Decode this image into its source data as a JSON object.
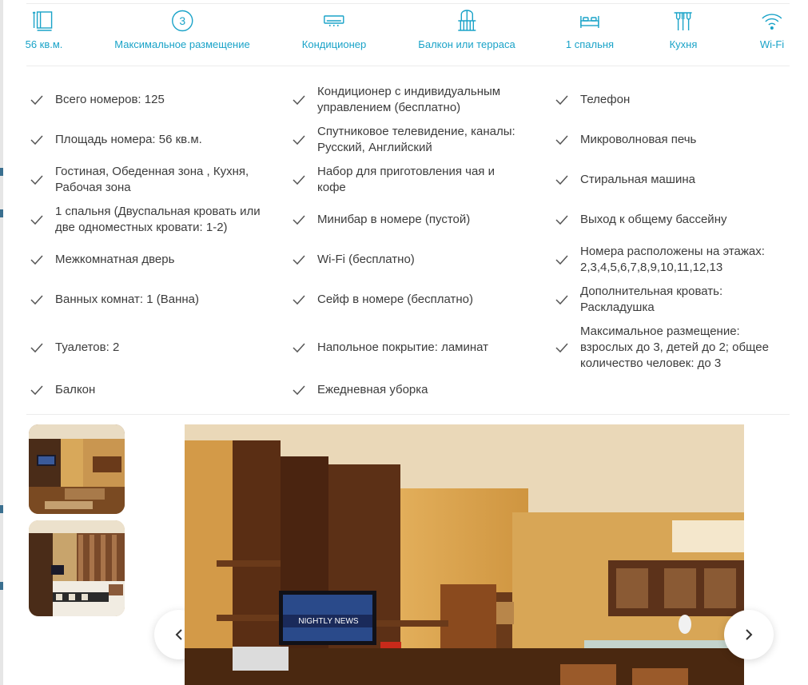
{
  "amenities": [
    {
      "label": "56 кв.м.",
      "icon": "area-icon"
    },
    {
      "label": "Максимальное размещение",
      "icon": "guests-count-icon",
      "badge": "3"
    },
    {
      "label": "Кондиционер",
      "icon": "air-conditioner-icon"
    },
    {
      "label": "Балкон или терраса",
      "icon": "balcony-icon"
    },
    {
      "label": "1 спальня",
      "icon": "bed-icon"
    },
    {
      "label": "Кухня",
      "icon": "kitchen-icon"
    },
    {
      "label": "Wi-Fi",
      "icon": "wifi-icon"
    }
  ],
  "features": {
    "col1": [
      "Всего номеров: 125",
      "Площадь номера: 56 кв.м.",
      "Гостиная, Обеденная зона , Кухня,\nРабочая зона",
      "1 спальня (Двуспальная кровать или\nдве одноместных кровати: 1-2)",
      "Межкомнатная дверь",
      "Ванных комнат: 1 (Ванна)",
      "Туалетов: 2",
      "Балкон"
    ],
    "col2": [
      "Кондиционер с индивидуальным\nуправлением (бесплатно)",
      "Спутниковое телевидение, каналы:\nРусский, Английский",
      "Набор для приготовления чая и\nкофе",
      "Минибар в номере (пустой)",
      "Wi-Fi (бесплатно)",
      "Сейф в номере (бесплатно)",
      "Напольное покрытие: ламинат",
      "Ежедневная уборка"
    ],
    "col3": [
      "Телефон",
      "Микроволновая печь",
      "Стиральная машина",
      "Выход к общему бассейну",
      "Номера расположены на этажах:\n2,3,4,5,6,7,8,9,10,11,12,13",
      "Дополнительная кровать:\nРаскладушка",
      "Максимальное размещение:\nвзрослых до 3, детей до 2; общее\nколичество человек: до 3"
    ]
  },
  "gallery": {
    "tv_caption": "NIGHTLY NEWS",
    "thumbnails": [
      "living-room-thumbnail",
      "bedroom-thumbnail"
    ],
    "prev_icon": "chevron-left-icon",
    "next_icon": "chevron-right-icon"
  },
  "colors": {
    "accent": "#1aa3c8",
    "text": "#3c3c3c",
    "divider": "#ececec"
  }
}
